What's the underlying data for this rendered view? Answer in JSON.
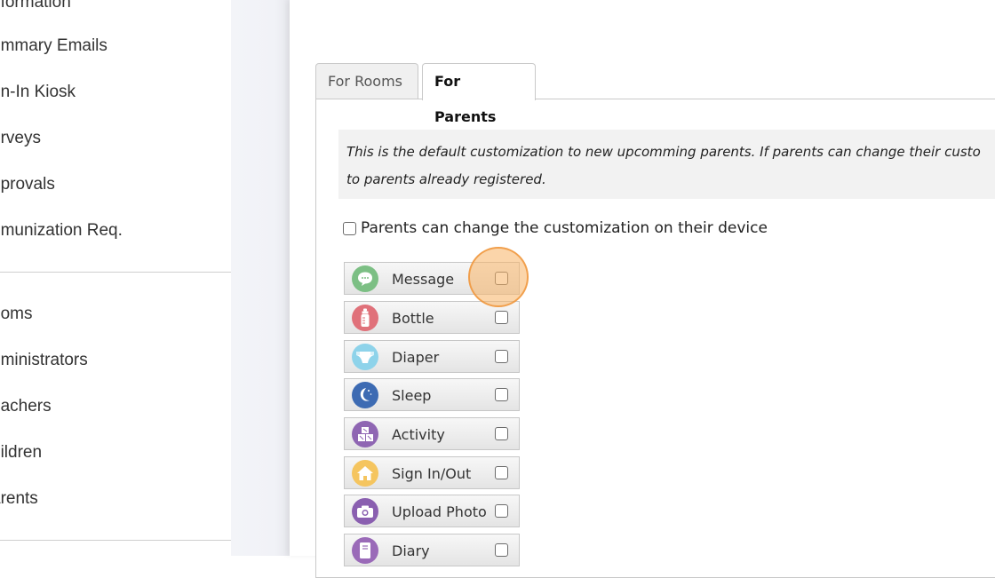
{
  "sidebar": {
    "items": [
      {
        "label": "nformation"
      },
      {
        "label": "ummary Emails"
      },
      {
        "label": "gn-In Kiosk"
      },
      {
        "label": "urveys"
      },
      {
        "label": "pprovals"
      },
      {
        "label": "nmunization Req."
      },
      {
        "label": "ooms"
      },
      {
        "label": "dministrators"
      },
      {
        "label": "eachers"
      },
      {
        "label": "hildren"
      },
      {
        "label": "arents"
      }
    ]
  },
  "tabs": [
    {
      "label": "For Rooms",
      "active": false
    },
    {
      "label": "For Parents",
      "active": true
    }
  ],
  "notice": {
    "line1": "This is the default customization to new upcomming parents. If parents can change their custo",
    "line2": "to parents already registered."
  },
  "allow_change": {
    "label": "Parents can change the customization on their device",
    "checked": false
  },
  "features": [
    {
      "label": "Message",
      "icon": "message-icon",
      "color": "#7cbf84",
      "checked": false
    },
    {
      "label": "Bottle",
      "icon": "bottle-icon",
      "color": "#e0717a",
      "checked": false
    },
    {
      "label": "Diaper",
      "icon": "diaper-icon",
      "color": "#8ed3ea",
      "checked": false
    },
    {
      "label": "Sleep",
      "icon": "sleep-icon",
      "color": "#3d6bb3",
      "checked": false
    },
    {
      "label": "Activity",
      "icon": "activity-icon",
      "color": "#8f66b3",
      "checked": false
    },
    {
      "label": "Sign In/Out",
      "icon": "home-icon",
      "color": "#f5c55f",
      "checked": false
    },
    {
      "label": "Upload Photo",
      "icon": "camera-icon",
      "color": "#8a5fb0",
      "checked": false
    },
    {
      "label": "Diary",
      "icon": "diary-icon",
      "color": "#9a6ab8",
      "checked": false
    }
  ],
  "highlight_color": "#f7b264"
}
